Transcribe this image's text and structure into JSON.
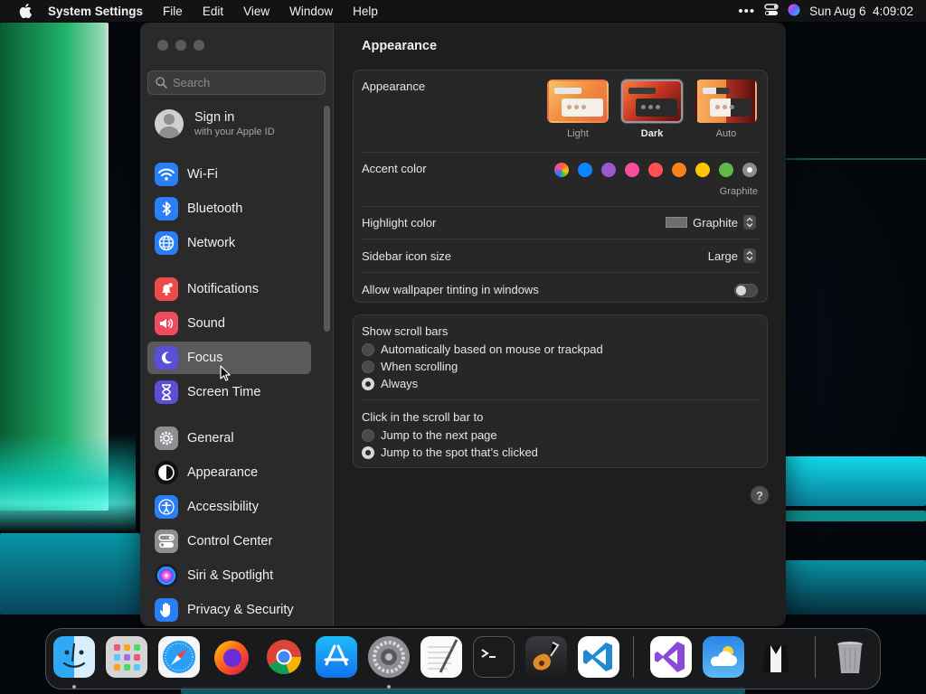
{
  "menubar": {
    "app_name": "System Settings",
    "items": [
      "File",
      "Edit",
      "View",
      "Window",
      "Help"
    ],
    "clock": "Sun Aug 6  4:09:02"
  },
  "sidebar": {
    "search_placeholder": "Search",
    "account": {
      "title": "Sign in",
      "subtitle": "with your Apple ID"
    },
    "items": [
      {
        "label": "Wi-Fi",
        "icon": "wifi-icon",
        "color": "#2b7ff6"
      },
      {
        "label": "Bluetooth",
        "icon": "bluetooth-icon",
        "color": "#2b7ff6"
      },
      {
        "label": "Network",
        "icon": "globe-icon",
        "color": "#2b7ff6"
      },
      {
        "label": "Notifications",
        "icon": "bell-icon",
        "color": "#ef4a4a"
      },
      {
        "label": "Sound",
        "icon": "speaker-icon",
        "color": "#ef4a60"
      },
      {
        "label": "Focus",
        "icon": "moon-icon",
        "color": "#5b4fd8"
      },
      {
        "label": "Screen Time",
        "icon": "hourglass-icon",
        "color": "#5b4fd8"
      },
      {
        "label": "General",
        "icon": "gear-icon",
        "color": "#8e8e93"
      },
      {
        "label": "Appearance",
        "icon": "appearance-icon",
        "color": "#101010"
      },
      {
        "label": "Accessibility",
        "icon": "accessibility-icon",
        "color": "#2b7ff6"
      },
      {
        "label": "Control Center",
        "icon": "toggles-icon",
        "color": "#8e8e93"
      },
      {
        "label": "Siri & Spotlight",
        "icon": "siri-icon",
        "color": "#1c1c30"
      },
      {
        "label": "Privacy & Security",
        "icon": "hand-icon",
        "color": "#2b7ff6"
      }
    ],
    "selected": "Focus"
  },
  "content": {
    "title": "Appearance",
    "appearance": {
      "label": "Appearance",
      "options": [
        "Light",
        "Dark",
        "Auto"
      ],
      "selected": "Dark"
    },
    "accent": {
      "label": "Accent color",
      "colors": [
        "multicolor",
        "#0a84ff",
        "#9b59d0",
        "#f74f9e",
        "#ff5257",
        "#f7821b",
        "#ffc600",
        "#62ba46",
        "#8c8c8c"
      ],
      "selected_name": "Graphite"
    },
    "highlight": {
      "label": "Highlight color",
      "value": "Graphite"
    },
    "icon_size": {
      "label": "Sidebar icon size",
      "value": "Large"
    },
    "tinting": {
      "label": "Allow wallpaper tinting in windows",
      "enabled": false
    },
    "scroll_bars": {
      "label": "Show scroll bars",
      "options": [
        "Automatically based on mouse or trackpad",
        "When scrolling",
        "Always"
      ],
      "selected": "Always"
    },
    "click_scroll": {
      "label": "Click in the scroll bar to",
      "options": [
        "Jump to the next page",
        "Jump to the spot that’s clicked"
      ],
      "selected": "Jump to the spot that’s clicked"
    },
    "help_label": "?"
  },
  "dock": {
    "apps": [
      "finder-icon",
      "launchpad-icon",
      "safari-icon",
      "firefox-icon",
      "chrome-icon",
      "app-store-icon",
      "system-settings-icon",
      "textedit-icon",
      "terminal-icon",
      "garageband-icon",
      "vscode-icon",
      "visual-studio-icon",
      "weather-icon",
      "tuxedo-icon",
      "trash-icon"
    ]
  }
}
